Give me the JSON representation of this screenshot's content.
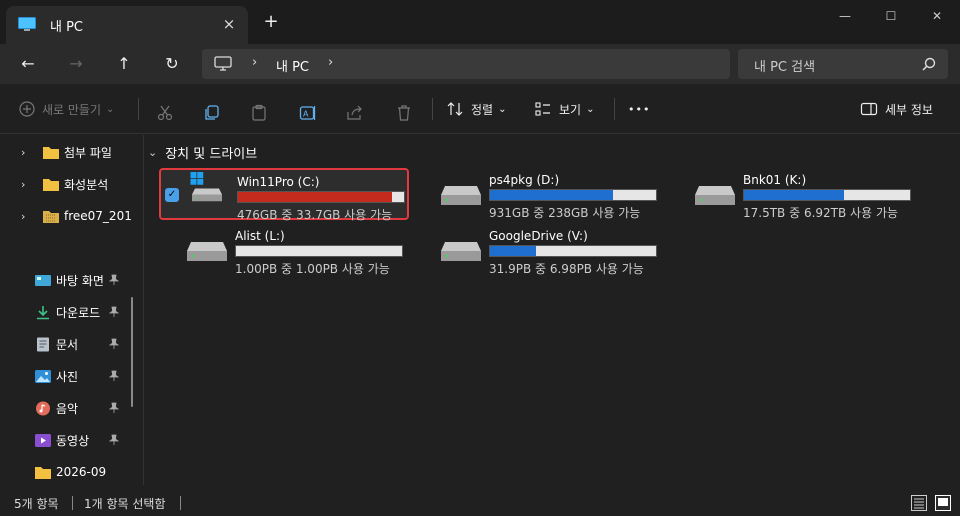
{
  "tab": {
    "title": "내 PC",
    "close_icon": "×",
    "new_tab_icon": "+"
  },
  "window_controls": {
    "minimize": "—",
    "maximize": "☐",
    "close": "✕"
  },
  "nav": {
    "back_icon": "←",
    "forward_icon": "→",
    "up_icon": "↑",
    "refresh_icon": "↻",
    "breadcrumb_sep": "›",
    "breadcrumb": [
      "내 PC"
    ],
    "search_placeholder": "내 PC 검색"
  },
  "commands": {
    "new_label": "새로 만들기",
    "sort_label": "정렬",
    "view_label": "보기",
    "more_label": "•••",
    "details_label": "세부 정보",
    "dropdown_icon": "⌄"
  },
  "sidebar": {
    "tree": [
      {
        "label": "첨부 파일",
        "icon": "folder-icon"
      },
      {
        "label": "화성분석",
        "icon": "folder-icon"
      },
      {
        "label": "free07_201",
        "icon": "folder-zip-icon"
      }
    ],
    "quick_access": [
      {
        "label": "바탕 화면",
        "icon": "desktop-icon",
        "pinned": true
      },
      {
        "label": "다운로드",
        "icon": "download-icon",
        "pinned": true
      },
      {
        "label": "문서",
        "icon": "document-icon",
        "pinned": true
      },
      {
        "label": "사진",
        "icon": "pictures-icon",
        "pinned": true
      },
      {
        "label": "음악",
        "icon": "music-icon",
        "pinned": true
      },
      {
        "label": "동영상",
        "icon": "video-icon",
        "pinned": true
      },
      {
        "label": "2026-09",
        "icon": "folder-icon",
        "pinned": false
      }
    ],
    "chevron": "›"
  },
  "section": {
    "title": "장치 및 드라이브",
    "chevron": "⌄"
  },
  "drives": [
    {
      "name": "Win11Pro (C:)",
      "free_text": "476GB 중 33.7GB 사용 가능",
      "used_fraction": 0.93,
      "selected": true,
      "system": true
    },
    {
      "name": "ps4pkg (D:)",
      "free_text": "931GB 중 238GB 사용 가능",
      "used_fraction": 0.74,
      "selected": false,
      "system": false
    },
    {
      "name": "Bnk01 (K:)",
      "free_text": "17.5TB 중 6.92TB 사용 가능",
      "used_fraction": 0.6,
      "selected": false,
      "system": false
    },
    {
      "name": "Alist (L:)",
      "free_text": "1.00PB 중 1.00PB 사용 가능",
      "used_fraction": 0.0,
      "selected": false,
      "system": false
    },
    {
      "name": "GoogleDrive (V:)",
      "free_text": "31.9PB 중 6.98PB 사용 가능",
      "used_fraction": 0.28,
      "selected": false,
      "system": false
    }
  ],
  "status": {
    "item_count": "5개 항목",
    "selected_count": "1개 항목 선택함"
  },
  "colors": {
    "bar_normal": "#1f6fd1",
    "bar_full": "#c42b1c",
    "selection_outline": "#e0393e",
    "checkbox": "#4aa0e8"
  }
}
